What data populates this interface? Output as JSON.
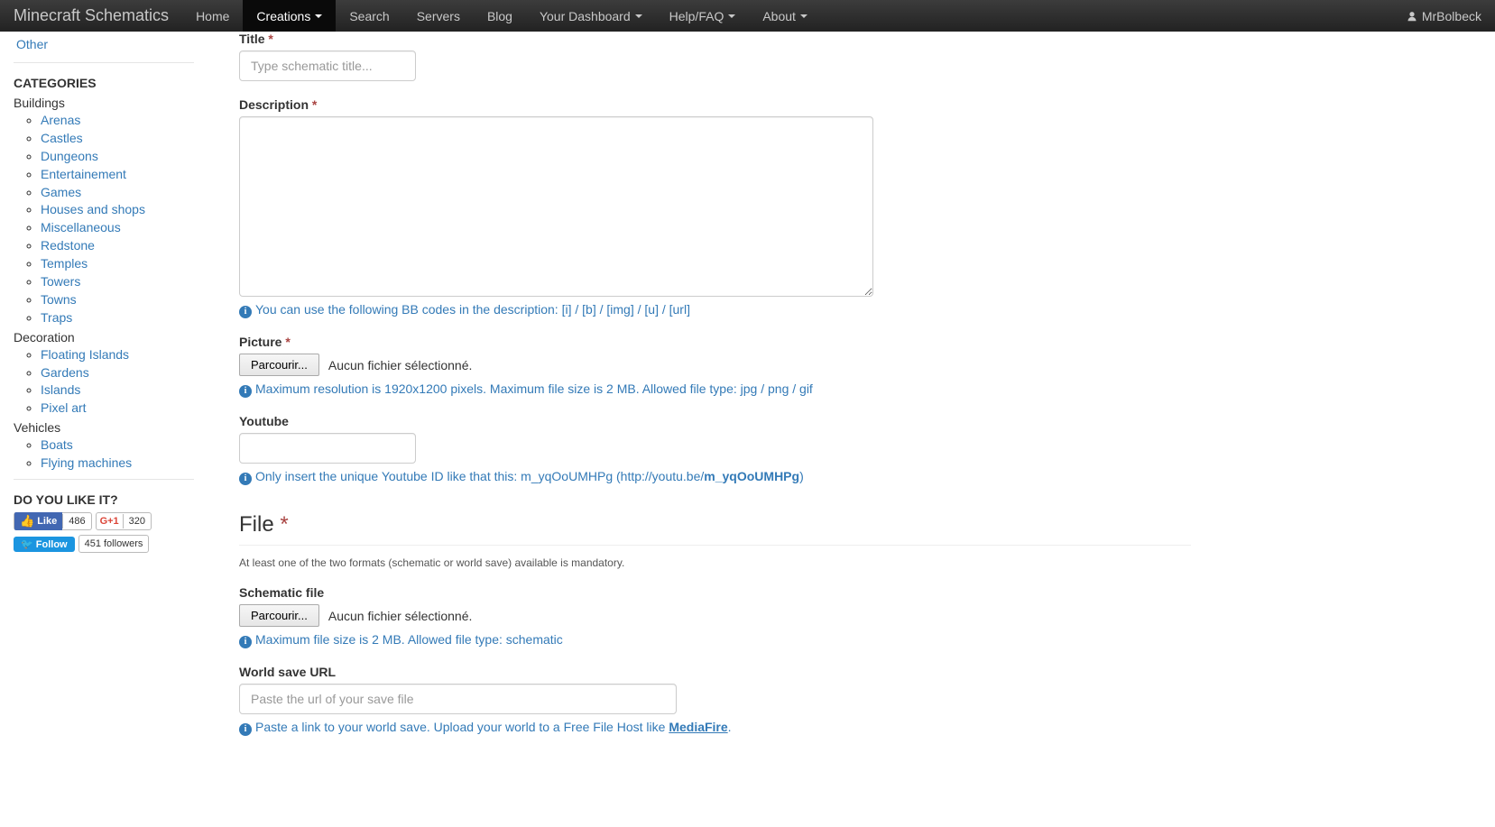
{
  "navbar": {
    "brand": "Minecraft Schematics",
    "items": [
      "Home",
      "Creations",
      "Search",
      "Servers",
      "Blog",
      "Your Dashboard",
      "Help/FAQ",
      "About"
    ],
    "user": "MrBolbeck"
  },
  "sidebar": {
    "top_link": "Other",
    "categories_title": "CATEGORIES",
    "groups": [
      {
        "head": "Buildings",
        "items": [
          "Arenas",
          "Castles",
          "Dungeons",
          "Entertainement",
          "Games",
          "Houses and shops",
          "Miscellaneous",
          "Redstone",
          "Temples",
          "Towers",
          "Towns",
          "Traps"
        ]
      },
      {
        "head": "Decoration",
        "items": [
          "Floating Islands",
          "Gardens",
          "Islands",
          "Pixel art"
        ]
      },
      {
        "head": "Vehicles",
        "items": [
          "Boats",
          "Flying machines"
        ]
      }
    ],
    "like_title": "DO YOU LIKE IT?",
    "social": {
      "fb_label": "Like",
      "fb_count": "486",
      "gplus_label": "G+1",
      "gplus_count": "320",
      "tw_label": "Follow",
      "tw_count": "451 followers"
    }
  },
  "form": {
    "title_label": "Title",
    "title_placeholder": "Type schematic title...",
    "desc_label": "Description",
    "desc_help": "You can use the following BB codes in the description: [i] / [b] / [img] / [u] / [url]",
    "picture_label": "Picture",
    "browse_btn": "Parcourir...",
    "no_file": "Aucun fichier sélectionné.",
    "picture_help": "Maximum resolution is 1920x1200 pixels. Maximum file size is 2 MB. Allowed file type: jpg / png / gif",
    "youtube_label": "Youtube",
    "youtube_help_pre": "Only insert the unique Youtube ID like that this: m_yqOoUMHPg (http://youtu.be/",
    "youtube_help_bold": "m_yqOoUMHPg",
    "youtube_help_post": ")",
    "file_section": "File",
    "file_note": "At least one of the two formats (schematic or world save) available is mandatory.",
    "schematic_label": "Schematic file",
    "schematic_help": "Maximum file size is 2 MB. Allowed file type: schematic",
    "world_label": "World save URL",
    "world_placeholder": "Paste the url of your save file",
    "world_help_pre": "Paste a link to your world save. Upload your world to a Free File Host like ",
    "world_help_link": "MediaFire",
    "world_help_post": "."
  }
}
